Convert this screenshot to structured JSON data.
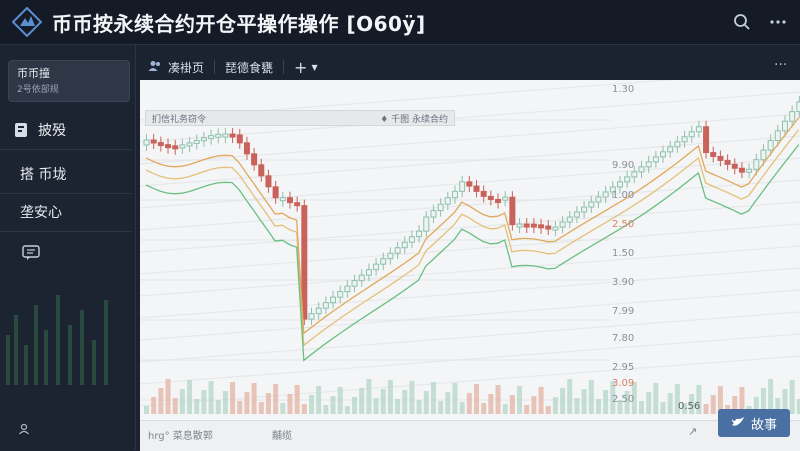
{
  "header": {
    "title": "币币按永续合约开仓平操作操作 [O60ÿ]",
    "icons": {
      "logo": "brand-logo-icon",
      "search": "search-icon",
      "more": "more-dots-icon"
    }
  },
  "sidebar": {
    "account": {
      "name": "币币撞",
      "sub": "2号依部规"
    },
    "items": [
      {
        "label": "披殁",
        "icon": "document-icon"
      },
      {
        "label": "搭 币垅",
        "icon": ""
      },
      {
        "label": "垄安心",
        "icon": ""
      }
    ],
    "chat_icon": "chat-icon",
    "bottom_icon": "user-icon"
  },
  "chart_panel": {
    "tabs": [
      {
        "label": "凑褂页",
        "icon": "users-icon"
      },
      {
        "label": "琵德食甕",
        "icon": ""
      }
    ],
    "add_label": "+",
    "more_label": "···",
    "toolbar": {
      "left": "扪信礼务窃令",
      "right": "♦ 千图 永续合约"
    },
    "price_ticks": [
      {
        "label": "1.30",
        "color": "grey"
      },
      {
        "label": "9.90",
        "color": "grey"
      },
      {
        "label": "1.00",
        "color": "grey"
      },
      {
        "label": "2.50",
        "color": "red"
      },
      {
        "label": "1.50",
        "color": "grey"
      },
      {
        "label": "3.90",
        "color": "grey"
      },
      {
        "label": "7.99",
        "color": "grey"
      },
      {
        "label": "7.80",
        "color": "grey"
      },
      {
        "label": "2.95",
        "color": "grey"
      },
      {
        "label": "3.09",
        "color": "red"
      },
      {
        "label": "2.50",
        "color": "grey"
      },
      {
        "label": "1.20",
        "color": "grey"
      }
    ],
    "bottom_left": "hrg°  菜息散郭",
    "bottom_mid": "黼缆",
    "bottom_tool": "↗",
    "bottom_tick": "0.56",
    "share_label": "故事",
    "colors": {
      "up": "#8fbfae",
      "down": "#c9625a",
      "ma_yellow": "#e5c07b",
      "ma_green": "#6abf84",
      "ma_orange": "#e2a85c"
    }
  }
}
